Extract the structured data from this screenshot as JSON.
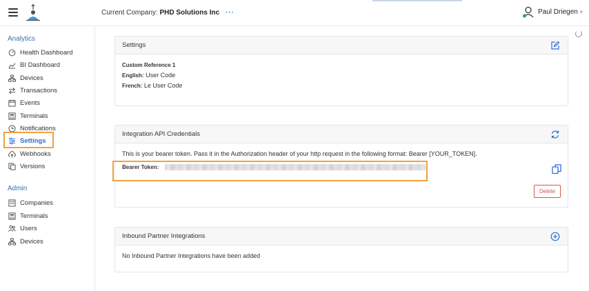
{
  "header": {
    "company_prefix": "Current Company:",
    "company_name": "PHD Solutions Inc",
    "company_menu": "···",
    "user_name": "Paul Driegen",
    "user_caret": "▿"
  },
  "sidebar": {
    "analytics_title": "Analytics",
    "analytics_items": [
      {
        "label": "Health Dashboard",
        "icon": "speedometer-icon"
      },
      {
        "label": "BI Dashboard",
        "icon": "chart-line-icon"
      },
      {
        "label": "Devices",
        "icon": "network-icon"
      },
      {
        "label": "Transactions",
        "icon": "arrows-exchange-icon"
      },
      {
        "label": "Events",
        "icon": "calendar-icon"
      },
      {
        "label": "Terminals",
        "icon": "terminal-grid-icon"
      },
      {
        "label": "Notifications",
        "icon": "clock-icon"
      },
      {
        "label": "Settings",
        "icon": "sliders-icon",
        "active": true
      },
      {
        "label": "Webhooks",
        "icon": "cloud-upload-icon"
      },
      {
        "label": "Versions",
        "icon": "copy-pages-icon"
      }
    ],
    "admin_title": "Admin",
    "admin_items": [
      {
        "label": "Companies",
        "icon": "building-icon"
      },
      {
        "label": "Terminals",
        "icon": "terminal-grid-icon"
      },
      {
        "label": "Users",
        "icon": "users-icon"
      },
      {
        "label": "Devices",
        "icon": "network-icon"
      }
    ]
  },
  "settings_card": {
    "title": "Settings",
    "ref_title": "Custom Reference 1",
    "english_label": "English:",
    "english_value": "User Code",
    "french_label": "French:",
    "french_value": "Le User Code"
  },
  "api_card": {
    "title": "Integration API Credentials",
    "description": "This is your bearer token. Pass it in the Authorization header of your http request in the following format: Bearer [YOUR_TOKEN].",
    "token_label": "Bearer Token:",
    "delete_label": "Delete"
  },
  "inbound_card": {
    "title": "Inbound Partner Integrations",
    "empty_text": "No Inbound Partner Integrations have been added"
  },
  "colors": {
    "accent": "#2b6cd8",
    "highlight": "#f0a13c",
    "danger": "#d9534f"
  }
}
